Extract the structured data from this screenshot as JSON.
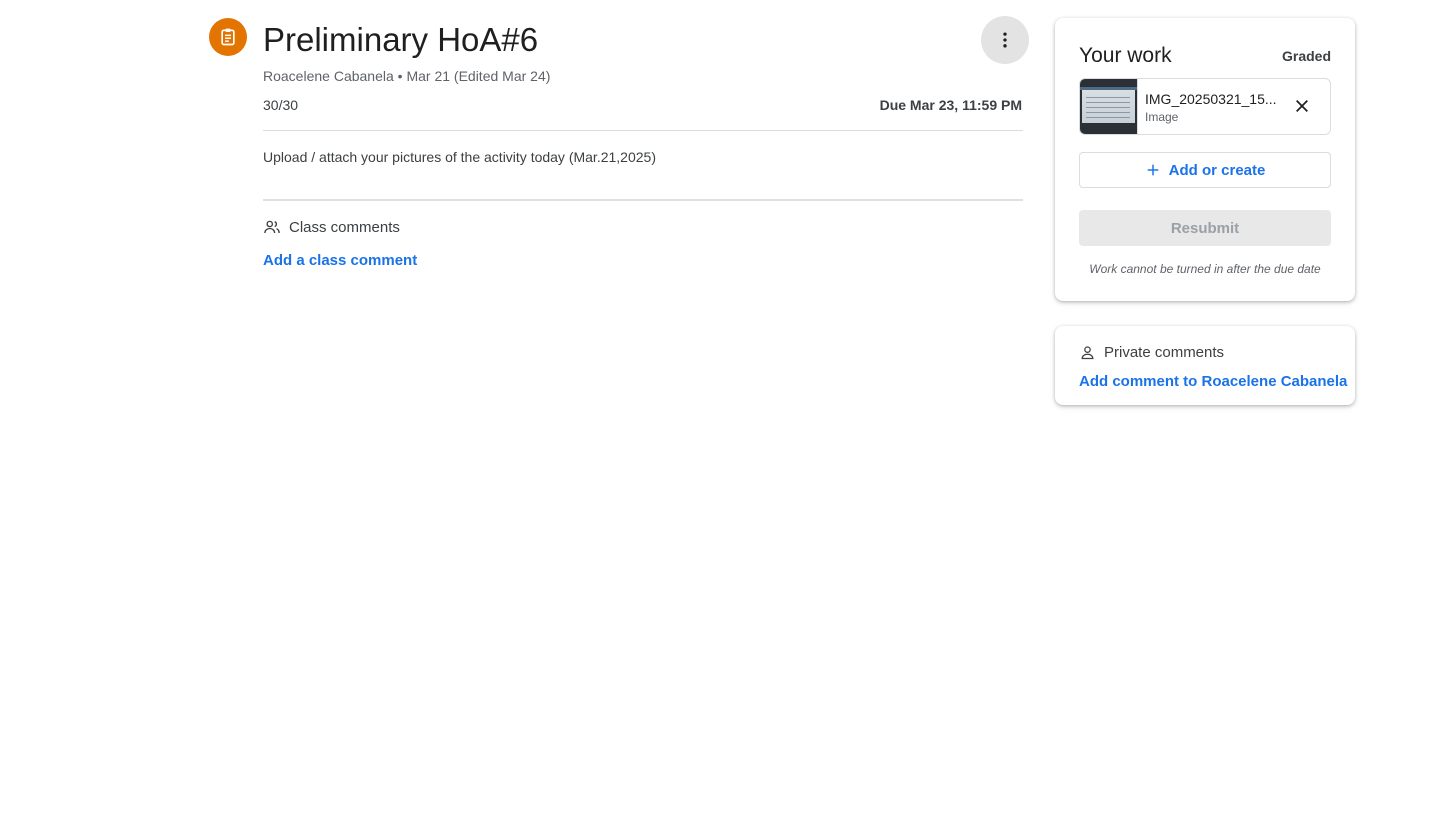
{
  "assignment": {
    "title": "Preliminary HoA#6",
    "author": "Roacelene Cabanela",
    "meta_separator": "•",
    "posted": "Mar 21 (Edited Mar 24)",
    "points": "30/30",
    "due": "Due Mar 23, 11:59 PM",
    "description": "Upload / attach your pictures of the activity today (Mar.21,2025)",
    "icon": "assignment-icon",
    "accent_color": "#e37400"
  },
  "class_comments": {
    "label": "Class comments",
    "add_label": "Add a class comment",
    "icon": "people-icon"
  },
  "your_work": {
    "title": "Your work",
    "status": "Graded",
    "attachment": {
      "name": "IMG_20250321_15...",
      "type": "Image"
    },
    "add_create_label": "Add or create",
    "resubmit_label": "Resubmit",
    "note": "Work cannot be turned in after the due date"
  },
  "private_comments": {
    "label": "Private comments",
    "add_label": "Add comment to Roacelene Cabanela",
    "icon": "person-icon"
  },
  "colors": {
    "link": "#1a73e8",
    "text_secondary": "#5f6368"
  }
}
